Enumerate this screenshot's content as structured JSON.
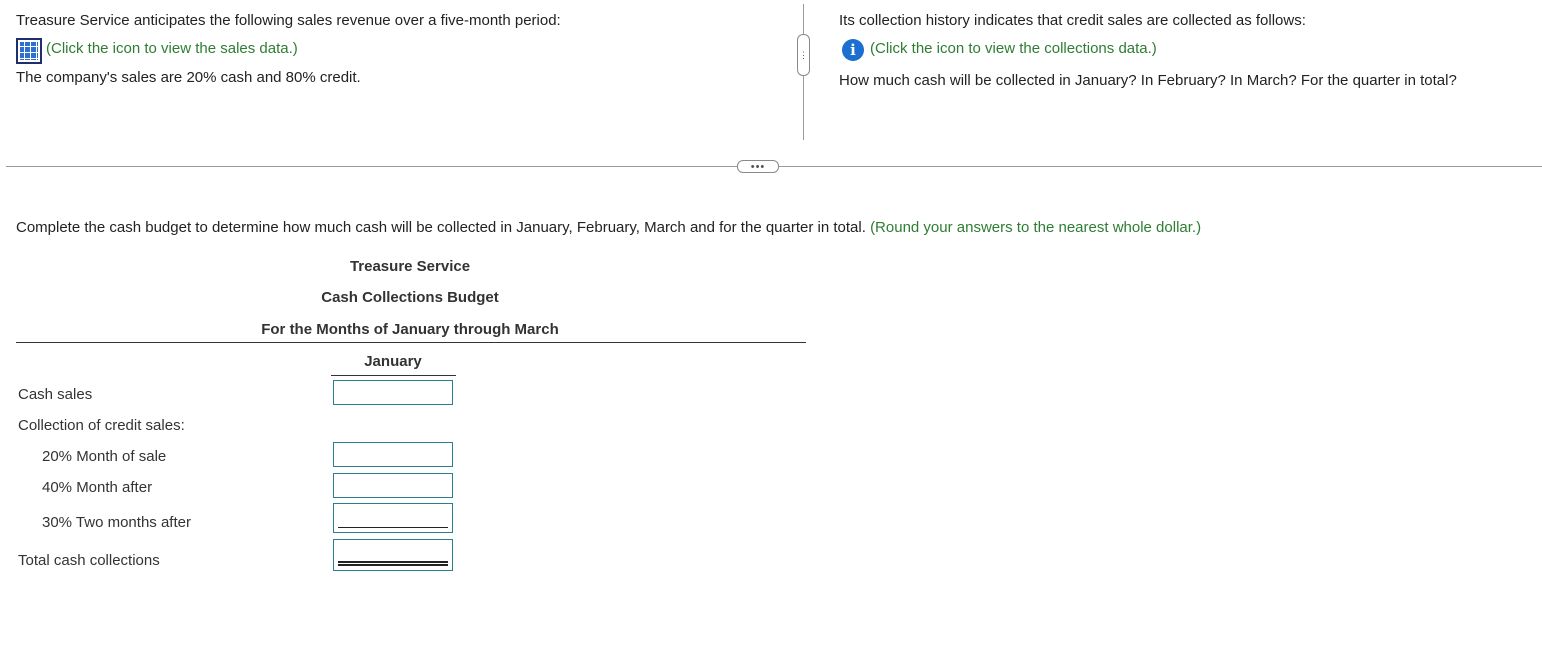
{
  "intro": {
    "left_line1": "Treasure Service anticipates the following sales revenue over a five-month period:",
    "sales_link": "(Click the icon to view the sales data.)",
    "left_line3": "The company's sales are 20% cash and 80% credit.",
    "right_line1": "Its collection history indicates that credit sales are collected as follows:",
    "collections_link": "(Click the icon to view the collections data.)",
    "right_line3": "How much cash will be collected in January? In February? In March? For the quarter in total?"
  },
  "instruction": {
    "text": "Complete the cash budget to determine how much cash will be collected in January, February, March and for the quarter in total.",
    "hint": "(Round your answers to the nearest whole dollar.)"
  },
  "budget": {
    "company": "Treasure Service",
    "title": "Cash Collections Budget",
    "period": "For the Months of January through March",
    "column": "January",
    "rows": {
      "cash_sales": "Cash sales",
      "collection_header": "Collection of credit sales:",
      "month_of_sale": "20% Month of sale",
      "month_after": "40% Month after",
      "two_months_after": "30% Two months after",
      "total": "Total cash collections"
    }
  },
  "colors": {
    "green": "#2e7d32",
    "input_border": "#2a7f8f",
    "icon_blue": "#1a6fd0"
  },
  "icons": {
    "sales_data": "spreadsheet-grid-icon",
    "collections_data": "info-icon"
  }
}
